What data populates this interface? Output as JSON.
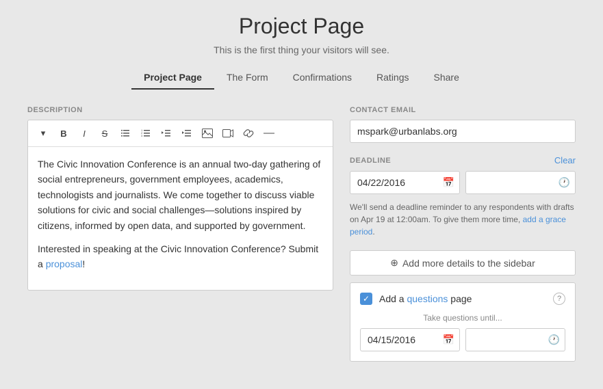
{
  "header": {
    "title": "Project Page",
    "subtitle": "This is the first thing your visitors will see."
  },
  "nav": {
    "tabs": [
      {
        "id": "project-page",
        "label": "Project Page",
        "active": true
      },
      {
        "id": "the-form",
        "label": "The Form",
        "active": false
      },
      {
        "id": "confirmations",
        "label": "Confirmations",
        "active": false
      },
      {
        "id": "ratings",
        "label": "Ratings",
        "active": false
      },
      {
        "id": "share",
        "label": "Share",
        "active": false
      }
    ]
  },
  "editor": {
    "section_label": "Description",
    "toolbar": {
      "dropdown": "▾",
      "bold": "B",
      "italic": "I",
      "strikethrough": "S",
      "ul": "☰",
      "ol": "≡",
      "outdent": "⇤",
      "indent": "⇥",
      "image": "🖼",
      "video": "▶",
      "link": "🔗",
      "divider": "—"
    },
    "content_para1": "The Civic Innovation Conference is an annual two-day gathering of social entrepreneurs, government employees, academics, technologists and journalists. We come together to discuss viable solutions for civic and social challenges—solutions inspired by citizens, informed by open data, and supported by government.",
    "content_para2_prefix": "Interested in speaking at the Civic Innovation Conference? Submit a ",
    "content_para2_link": "proposal",
    "content_para2_suffix": "!"
  },
  "sidebar": {
    "contact_email": {
      "label": "CONTACT EMAIL",
      "value": "mspark@urbanlabs.org",
      "placeholder": "mspark@urbanlabs.org"
    },
    "deadline": {
      "label": "DEADLINE",
      "clear_label": "Clear",
      "date_value": "04/22/2016",
      "time_value": "",
      "hint": "We'll send a deadline reminder to any respondents with drafts on Apr 19 at 12:00am. To give them more time, ",
      "hint_link": "add a grace period",
      "hint_suffix": "."
    },
    "add_details": {
      "icon": "⊕",
      "label": "Add more details to the sidebar"
    },
    "questions": {
      "checked": true,
      "label_prefix": "Add a ",
      "label_link": "questions",
      "label_suffix": " page",
      "take_until_label": "Take questions until...",
      "date_value": "04/15/2016",
      "time_value": "",
      "help": "?"
    }
  }
}
